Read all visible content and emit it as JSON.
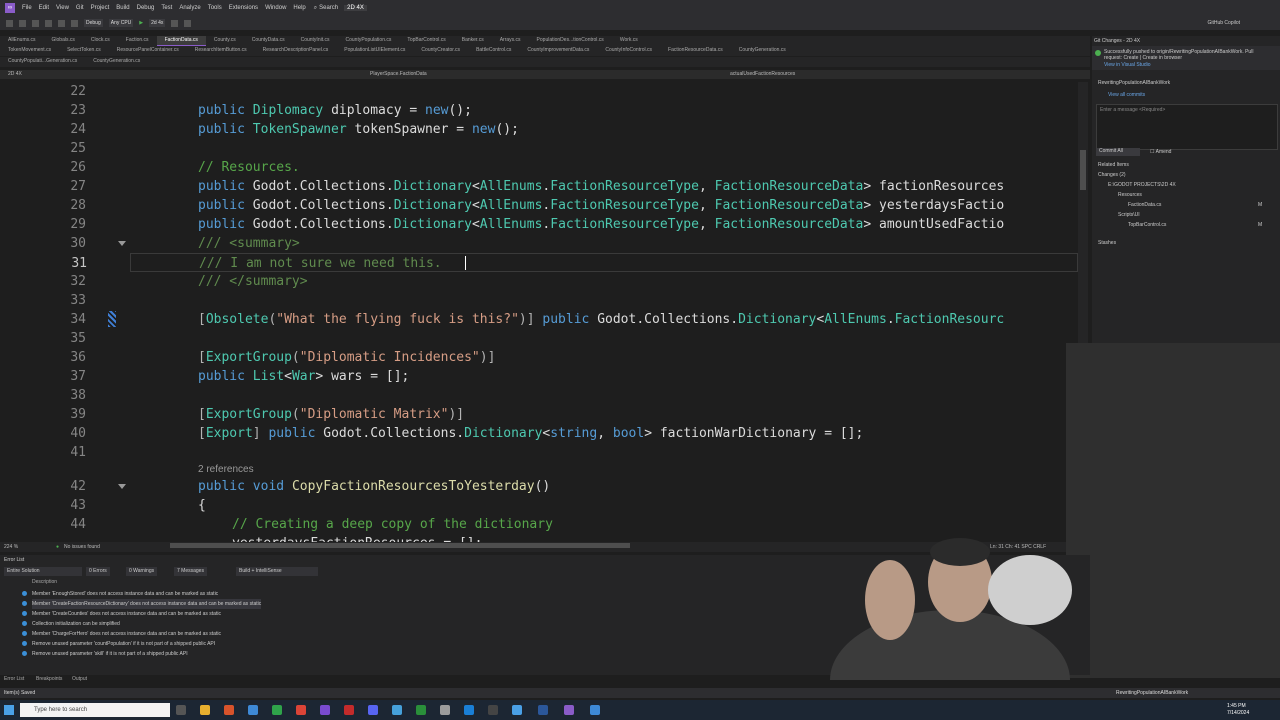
{
  "menubar": {
    "items": [
      "File",
      "Edit",
      "View",
      "Git",
      "Project",
      "Build",
      "Debug",
      "Test",
      "Analyze",
      "Tools",
      "Extensions",
      "Window",
      "Help"
    ],
    "search_label": "Search",
    "solution": "2D 4X"
  },
  "toolbar": {
    "config": "Debug",
    "platform": "Any CPU",
    "run_target": "2d 4x",
    "github_copilot": "GitHub Copilot"
  },
  "tabs": {
    "row1": [
      "AllEnums.cs",
      "Globals.cs",
      "Clock.cs",
      "Faction.cs",
      "FactionData.cs",
      "County.cs",
      "CountyData.cs",
      "CountyInit.cs",
      "CountyPopulation.cs",
      "TopBarControl.cs",
      "Banker.cs",
      "Arrays.cs",
      "PopulationDes...tionControl.cs",
      "Work.cs"
    ],
    "row2": [
      "TokenMovement.cs",
      "SelectToken.cs",
      "ResourcePanelContainer.cs",
      "ResearchItemButton.cs",
      "ResearchDescriptionPanel.cs",
      "PopulationListUIElement.cs",
      "CountyCreator.cs",
      "BattleControl.cs",
      "CountyImprovementData.cs",
      "CountyInfoControl.cs",
      "FactionResourceData.cs",
      "CountyGeneration.cs"
    ],
    "row3": [
      "CountyPopulati...Generation.cs",
      "CountyGeneration.cs"
    ],
    "active": "FactionData.cs"
  },
  "navbar": {
    "left": "2D 4X",
    "middle": "PlayerSpace.FactionData",
    "right": "actualUsedFactionResources"
  },
  "editor": {
    "lines": {
      "n22": "22",
      "n23": "23",
      "n24": "24",
      "n25": "25",
      "n26": "26",
      "n27": "27",
      "n28": "28",
      "n29": "29",
      "n30": "30",
      "n31": "31",
      "n32": "32",
      "n33": "33",
      "n34": "34",
      "n35": "35",
      "n36": "36",
      "n37": "37",
      "n38": "38",
      "n39": "39",
      "n40": "40",
      "n41": "41",
      "n42": "42",
      "n43": "43",
      "n44": "44"
    },
    "code": {
      "l23": [
        "public",
        " Diplomacy",
        " diplomacy = ",
        "new",
        "();"
      ],
      "l24": [
        "public",
        " TokenSpawner",
        " tokenSpawner = ",
        "new",
        "();"
      ],
      "l26": "// Resources.",
      "l27": [
        "public",
        " Godot.Collections.",
        "Dictionary",
        "<",
        "AllEnums",
        ".",
        "FactionResourceType",
        ", ",
        "FactionResourceData",
        "> factionResources"
      ],
      "l28": [
        "public",
        " Godot.Collections.",
        "Dictionary",
        "<",
        "AllEnums",
        ".",
        "FactionResourceType",
        ", ",
        "FactionResourceData",
        "> yesterdaysFactio"
      ],
      "l29": [
        "public",
        " Godot.Collections.",
        "Dictionary",
        "<",
        "AllEnums",
        ".",
        "FactionResourceType",
        ", ",
        "FactionResourceData",
        "> amountUsedFactio"
      ],
      "l30": "/// <summary>",
      "l31": "/// I am not sure we need this.",
      "l32": "/// </summary>",
      "l34": [
        "[",
        "Obsolete",
        "(",
        "\"What the flying fuck is this?\"",
        ")] ",
        "public",
        " Godot.Collections.",
        "Dictionary",
        "<",
        "AllEnums",
        ".",
        "FactionResourc"
      ],
      "l36": [
        "[",
        "ExportGroup",
        "(",
        "\"Diplomatic Incidences\"",
        ")]"
      ],
      "l37": [
        "public",
        " List",
        "<",
        "War",
        "> wars = [];"
      ],
      "l39": [
        "[",
        "ExportGroup",
        "(",
        "\"Diplomatic Matrix\"",
        ")]"
      ],
      "l40": [
        "[",
        "Export",
        "] ",
        "public",
        " Godot.Collections.",
        "Dictionary",
        "<",
        "string",
        ", ",
        "bool",
        "> factionWarDictionary = [];"
      ],
      "refs": "2 references",
      "l42": [
        "public",
        " void",
        " ",
        "CopyFactionResourcesToYesterday",
        "()"
      ],
      "l43": "{",
      "l44": "// Creating a deep copy of the dictionary",
      "l45": "yesterdaysFactionResources = [];"
    },
    "status": {
      "zoom": "224 %",
      "issues": "No issues found",
      "position": "Ln: 31   Ch: 41   SPC   CRLF"
    }
  },
  "git_panel": {
    "header": "Git Changes - 2D 4X",
    "banner": "Successfully pushed to origin/RewritingPopulationAIBankWork. Pull request: Create | Create in browser",
    "banner_link": "View in Visual Studio",
    "branch": "RewritingPopulationAIBankWork",
    "outgoing": "View all commits",
    "message_placeholder": "Enter a message <Required>",
    "commit_all": "Commit All",
    "amend": "Amend",
    "related": "Related Items",
    "changes": "Changes (2)",
    "path": "E:\\GODOT PROJECTS\\2D 4X",
    "folder1": "Resources",
    "file1": "FactionData.cs",
    "folder2": "Scripts\\UI",
    "file2": "TopBarControl.cs",
    "stashes": "Stashes",
    "m1": "M",
    "m2": "M"
  },
  "error_list": {
    "title": "Error List",
    "scope": "Entire Solution",
    "errors": "0 Errors",
    "warnings": "0 Warnings",
    "messages": "7 Messages",
    "build": "Build + IntelliSense",
    "description_header": "Description",
    "rows": [
      "Member 'EnoughStored' does not access instance data and can be marked as static",
      "Member 'CreateFactionResourceDictionary' does not access instance data and can be marked as static",
      "Member 'CreateCounties' does not access instance data and can be marked as static",
      "Collection initialization can be simplified",
      "Member 'ChargeForHero' does not access instance data and can be marked as static",
      "Remove unused parameter 'countPopulation' if it is not part of a shipped public API",
      "Remove unused parameter 'skill' if it is not part of a shipped public API"
    ]
  },
  "bottom_tabs": [
    "Error List",
    "Breakpoints",
    "Output"
  ],
  "statusbar": {
    "left": "Item(s) Saved",
    "branch": "RewritingPopulationAIBankWork"
  },
  "taskbar": {
    "search": "Type here to search",
    "time": "1:45 PM",
    "date": "7/14/2024"
  },
  "colors": {
    "accent": "#8a5cc9",
    "keyword": "#569cd6",
    "type": "#4ec9b0",
    "comment": "#57a64a",
    "string": "#d69d85"
  }
}
